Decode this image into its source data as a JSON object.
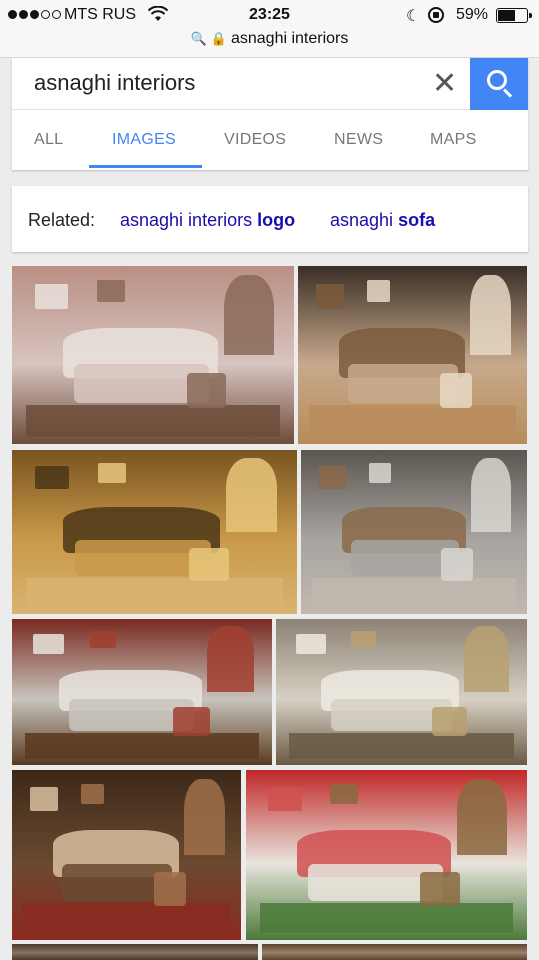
{
  "status": {
    "carrier": "MTS RUS",
    "time": "23:25",
    "battery_pct": "59%",
    "battery_level": 0.59,
    "signal_bars": 3
  },
  "address": {
    "url": "asnaghi interiors"
  },
  "search": {
    "query": "asnaghi interiors",
    "icons": {
      "clear": "close-icon",
      "search": "search-icon"
    }
  },
  "tabs": [
    {
      "label": "ALL",
      "active": false
    },
    {
      "label": "IMAGES",
      "active": true
    },
    {
      "label": "VIDEOS",
      "active": false
    },
    {
      "label": "NEWS",
      "active": false
    },
    {
      "label": "MAPS",
      "active": false
    }
  ],
  "related": {
    "label": "Related:",
    "chips": [
      {
        "normal": "asnaghi interiors ",
        "bold": "logo"
      },
      {
        "normal": "asnaghi ",
        "bold": "sofa"
      }
    ]
  },
  "colors": {
    "accent": "#4285f4",
    "link": "#1a0dab"
  },
  "images": [
    {
      "name": "bedroom-pink-gold",
      "palette": [
        "#b98f84",
        "#d8c4c0",
        "#8a6a58",
        "#e9e2dc",
        "#6d4c3a"
      ]
    },
    {
      "name": "salon-dark-sofas",
      "palette": [
        "#3a2e26",
        "#c7a98c",
        "#e8d8c4",
        "#7d5a3c",
        "#b88c5a"
      ]
    },
    {
      "name": "dining-gold-cabinets",
      "palette": [
        "#7a5420",
        "#c99a4a",
        "#e6c57a",
        "#4c3618",
        "#d8b370"
      ]
    },
    {
      "name": "bedroom-grey-silver",
      "palette": [
        "#5c5650",
        "#a8a4a0",
        "#d8d6d0",
        "#8b6a4a",
        "#c0b8ae"
      ]
    },
    {
      "name": "bedroom-red-walls",
      "palette": [
        "#7a2a20",
        "#c8c4bc",
        "#a04030",
        "#e8e4dc",
        "#5a3a20"
      ]
    },
    {
      "name": "bedroom-white-gold",
      "palette": [
        "#8c8274",
        "#d6d0c4",
        "#b8a070",
        "#eeeae2",
        "#6a5a44"
      ]
    },
    {
      "name": "salon-brown-velvet",
      "palette": [
        "#3c2818",
        "#6a4a30",
        "#a0704a",
        "#d8c0a0",
        "#8a2a20"
      ]
    },
    {
      "name": "salon-red-sofa",
      "palette": [
        "#c02828",
        "#e8e4dc",
        "#8a6a40",
        "#d05050",
        "#4c7a3a"
      ]
    },
    {
      "name": "bottom-left-partial",
      "palette": [
        "#4a3a2a",
        "#8a7060"
      ]
    },
    {
      "name": "bottom-right-partial",
      "palette": [
        "#5a4430",
        "#9a8066"
      ]
    }
  ]
}
